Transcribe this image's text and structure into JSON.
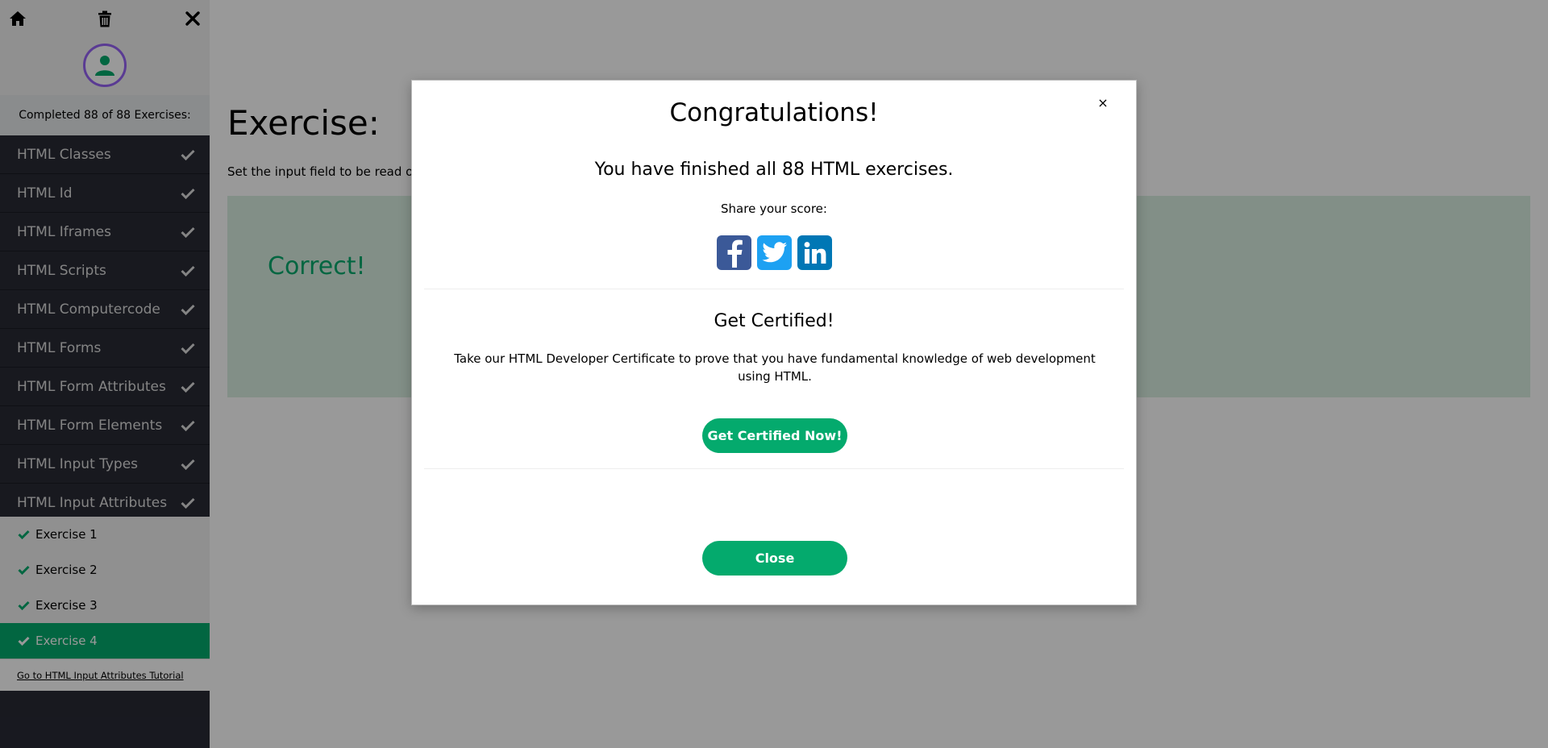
{
  "sidebar": {
    "icons": {
      "home": "home-icon",
      "trash": "trash-icon",
      "close": "close-icon"
    },
    "completed_text": "Completed 88 of 88 Exercises:",
    "chapters": [
      {
        "label": "HTML Classes"
      },
      {
        "label": "HTML Id"
      },
      {
        "label": "HTML Iframes"
      },
      {
        "label": "HTML Scripts"
      },
      {
        "label": "HTML Computercode"
      },
      {
        "label": "HTML Forms"
      },
      {
        "label": "HTML Form Attributes"
      },
      {
        "label": "HTML Form Elements"
      },
      {
        "label": "HTML Input Types"
      },
      {
        "label": "HTML Input Attributes"
      }
    ],
    "exercises": [
      {
        "label": "Exercise 1"
      },
      {
        "label": "Exercise 2"
      },
      {
        "label": "Exercise 3"
      },
      {
        "label": "Exercise 4",
        "active": true
      }
    ],
    "tutorial_link": "Go to HTML Input Attributes Tutorial"
  },
  "main": {
    "title": "Exercise:",
    "description": "Set the input field to be read o",
    "correct": "Correct!"
  },
  "modal": {
    "close_x": "×",
    "title": "Congratulations!",
    "finished": "You have finished all 88 HTML exercises.",
    "share": "Share your score:",
    "social": [
      "facebook-icon",
      "twitter-icon",
      "linkedin-icon"
    ],
    "get_certified": "Get Certified!",
    "cert_text": "Take our HTML Developer Certificate to prove that you have fundamental knowledge of web development using HTML.",
    "cert_button": "Get Certified Now!",
    "close_button": "Close"
  },
  "colors": {
    "accent_green": "#04aa6d",
    "sidebar_dark": "#282a35",
    "avatar_ring": "#9763f6",
    "facebook": "#3b5998",
    "twitter": "#1da1f2",
    "linkedin": "#0077b5"
  }
}
